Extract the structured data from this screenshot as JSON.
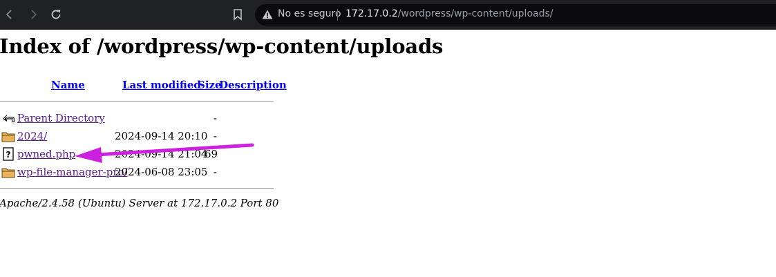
{
  "browser": {
    "security_label": "No es seguro",
    "url_host": "172.17.0.2",
    "url_path": "/wordpress/wp-content/uploads/",
    "icons": {
      "back": "arrow-left-icon",
      "forward": "arrow-right-icon",
      "reload": "reload-icon",
      "bookmark": "bookmark-icon",
      "warning": "warning-triangle-icon"
    }
  },
  "page": {
    "title": "Index of /wordpress/wp-content/uploads",
    "columns": {
      "name": "Name",
      "last_modified": "Last modified",
      "size": "Size",
      "description": "Description"
    },
    "entries": [
      {
        "icon": "parent-directory-icon",
        "name": "Parent Directory",
        "modified": "",
        "size": "-"
      },
      {
        "icon": "folder-icon",
        "name": "2024/",
        "modified": "2024-09-14 20:10",
        "size": "-"
      },
      {
        "icon": "unknown-file-icon",
        "name": "pwned.php",
        "modified": "2024-09-14 21:04",
        "size": "69"
      },
      {
        "icon": "folder-icon",
        "name": "wp-file-manager-pro/",
        "modified": "2024-06-08 23:05",
        "size": "-"
      }
    ],
    "footer": "Apache/2.4.58 (Ubuntu) Server at 172.17.0.2 Port 80"
  },
  "annotation": {
    "arrow_color": "#cc22e0",
    "icon": "annotation-arrow-icon"
  }
}
